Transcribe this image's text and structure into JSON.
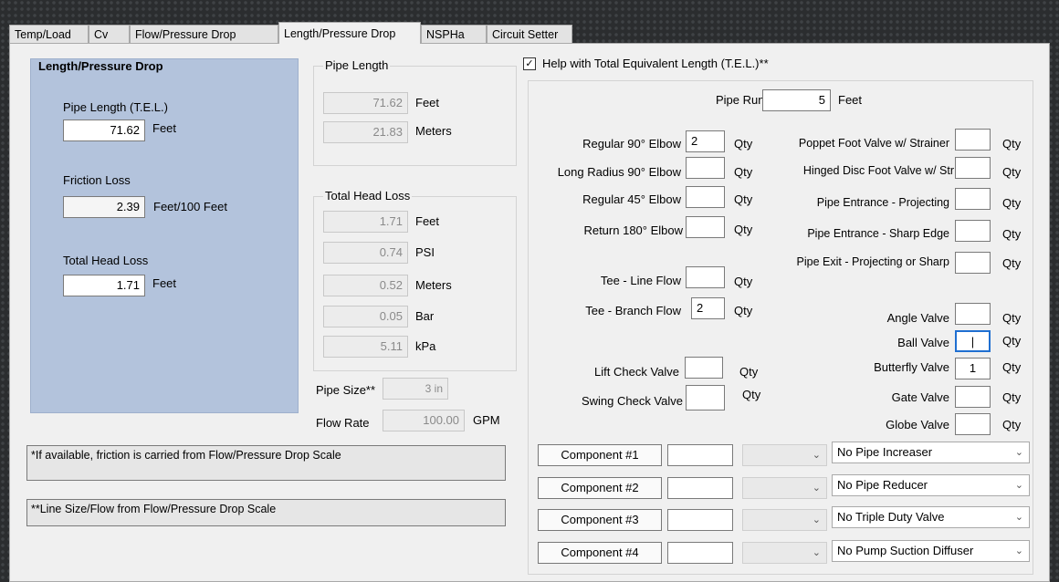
{
  "tabs": [
    "Temp/Load",
    "Cv",
    "Flow/Pressure Drop",
    "Length/Pressure Drop",
    "NSPHa",
    "Circuit Setter"
  ],
  "summary": {
    "title": "Length/Pressure Drop",
    "pipe_length_label": "Pipe Length (T.E.L.)",
    "pipe_length_value": "71.62",
    "pipe_length_unit": "Feet",
    "friction_label": "Friction Loss",
    "friction_value": "2.39",
    "friction_unit": "Feet/100 Feet",
    "total_head_label": "Total Head Loss",
    "total_head_value": "1.71",
    "total_head_unit": "Feet"
  },
  "pipe_length_group": {
    "title": "Pipe Length",
    "rows": [
      {
        "value": "71.62",
        "unit": "Feet"
      },
      {
        "value": "21.83",
        "unit": "Meters"
      }
    ]
  },
  "head_loss_group": {
    "title": "Total Head Loss",
    "rows": [
      {
        "value": "1.71",
        "unit": "Feet"
      },
      {
        "value": "0.74",
        "unit": "PSI"
      },
      {
        "value": "0.52",
        "unit": "Meters"
      },
      {
        "value": "0.05",
        "unit": "Bar"
      },
      {
        "value": "5.11",
        "unit": "kPa"
      }
    ]
  },
  "pipe_size": {
    "label": "Pipe Size**",
    "value": "3 in"
  },
  "flow_rate": {
    "label": "Flow Rate",
    "value": "100.00",
    "unit": "GPM"
  },
  "notes": [
    "*If available, friction is carried from Flow/Pressure Drop Scale",
    "**Line Size/Flow from Flow/Pressure Drop Scale"
  ],
  "tel": {
    "checkbox_label": "Help with Total Equivalent Length (T.E.L.)**",
    "checked": true,
    "pipe_run_label": "Pipe Run",
    "pipe_run_value": "5",
    "pipe_run_unit": "Feet",
    "qty": "Qty",
    "left_fittings": [
      {
        "label": "Regular 90° Elbow",
        "value": "2"
      },
      {
        "label": "Long Radius 90° Elbow",
        "value": ""
      },
      {
        "label": "Regular 45° Elbow",
        "value": ""
      },
      {
        "label": "Return 180° Elbow",
        "value": ""
      },
      {
        "label": "Tee - Line Flow",
        "value": ""
      },
      {
        "label": "Tee - Branch Flow",
        "value": "2"
      },
      {
        "label": "Lift Check Valve",
        "value": ""
      },
      {
        "label": "Swing Check Valve",
        "value": ""
      }
    ],
    "right_fittings": [
      {
        "label": "Poppet Foot Valve w/ Strainer",
        "value": ""
      },
      {
        "label": "Hinged Disc Foot Valve w/ Str",
        "value": ""
      },
      {
        "label": "Pipe Entrance - Projecting",
        "value": ""
      },
      {
        "label": "Pipe Entrance -  Sharp Edge",
        "value": ""
      },
      {
        "label": "Pipe Exit -  Projecting or Sharp",
        "value": ""
      },
      {
        "label": "Angle Valve",
        "value": ""
      },
      {
        "label": "Ball Valve",
        "value": "|"
      },
      {
        "label": "Butterfly Valve",
        "value": "1"
      },
      {
        "label": "Gate Valve",
        "value": ""
      },
      {
        "label": "Globe Valve",
        "value": ""
      }
    ],
    "components": [
      {
        "label": "Component #1",
        "option": "No Pipe Increaser"
      },
      {
        "label": "Component #2",
        "option": "No Pipe Reducer"
      },
      {
        "label": "Component #3",
        "option": "No Triple Duty Valve"
      },
      {
        "label": "Component #4",
        "option": "No Pump Suction Diffuser"
      }
    ]
  },
  "colors": {
    "summary_bg": "#b3c3dc",
    "panel_bg": "#f0f0f0",
    "window_bg": "#2b2d2f"
  }
}
